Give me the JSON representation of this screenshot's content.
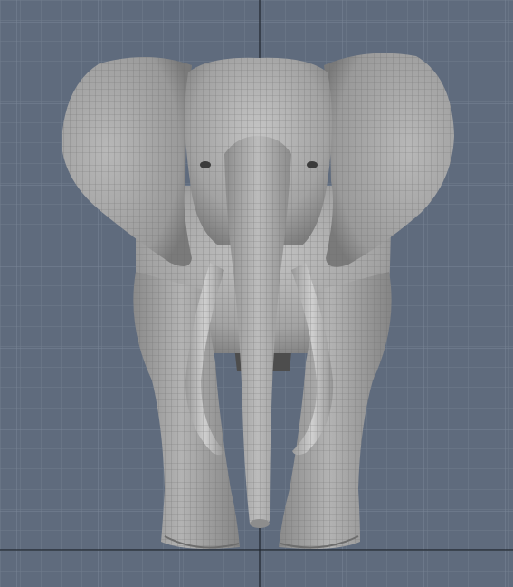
{
  "viewport": {
    "view": "front",
    "background_color": "#5f6b7d",
    "grid_color": "#6f7b8c",
    "axis_color": "#1e242c",
    "grid": true
  },
  "model": {
    "object": "elephant",
    "display": "wireframe-on-shaded",
    "shading_color": "#a9a9a9",
    "wire_color": "#6a6a6a"
  }
}
